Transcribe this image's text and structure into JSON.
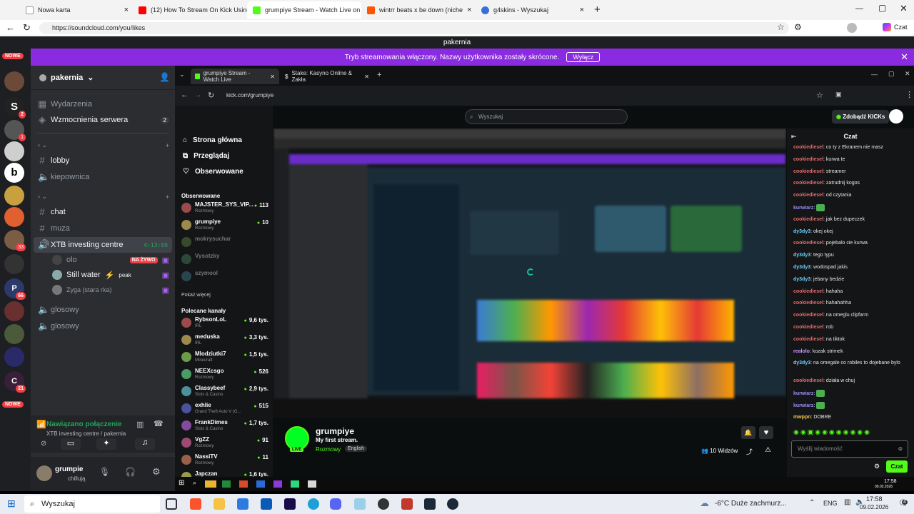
{
  "browser": {
    "tabs": [
      {
        "title": "Nowa karta"
      },
      {
        "title": "(12) How To Stream On Kick Using"
      },
      {
        "title": "grumpiye Stream - Watch Live on"
      },
      {
        "title": "wintrr beats x be down (niche"
      },
      {
        "title": "g4skins - Wyszukaj"
      }
    ],
    "url": "https://soundcloud.com/you/likes",
    "profile_label": "Czat"
  },
  "discord": {
    "window_title": "pakernia",
    "banner_text": "Tryb streamowania włączony. Nazwy użytkownika zostały skrócone.",
    "banner_button": "Wyłącz",
    "new_badge": "NOWE",
    "guild_badges": [
      "2",
      "1",
      "33",
      "66",
      "21"
    ],
    "server_name": "pakernia",
    "items": [
      {
        "label": "Wydarzenia"
      },
      {
        "label": "Wzmocnienia serwera",
        "badge": "2"
      }
    ],
    "channels": [
      {
        "label": "lobby"
      },
      {
        "label": "kiepownica"
      },
      {
        "label": "chat"
      },
      {
        "label": "muza"
      },
      {
        "label": "XTB investing centre",
        "time": "4:13:09"
      }
    ],
    "voice_users": [
      {
        "name": "olo",
        "badge": "NA ŻYWO"
      },
      {
        "name": "Still water",
        "extra": "peak"
      },
      {
        "name": "Zyga (stara rka)"
      }
    ],
    "more_channels": [
      "glosowy",
      "glosowy"
    ],
    "voice_status": "Nawiązano połączenie",
    "voice_sub": "XTB investing centre / pakernia",
    "user_name": "grumpie",
    "user_status": "chillują"
  },
  "kick": {
    "tabs": [
      "grumpiye Stream - Watch Live",
      "Stake: Kasyno Online & Zakła"
    ],
    "url": "kick.com/grumpiye",
    "search_placeholder": "Wyszukaj",
    "get_kicks": "Zdobądź KICKs",
    "nav": [
      "Strona główna",
      "Przeglądaj",
      "Obserwowane"
    ],
    "followed_header": "Obserwowane",
    "followed": [
      {
        "name": "MAJSTER_SYS_VIP...",
        "cat": "Rozmowy",
        "viewers": "113"
      },
      {
        "name": "grumpiye",
        "cat": "Rozmowy",
        "viewers": "10"
      },
      {
        "name": "mokrysuchar",
        "cat": "",
        "viewers": ""
      },
      {
        "name": "Vysotzky",
        "cat": "",
        "viewers": ""
      },
      {
        "name": "szymool",
        "cat": "",
        "viewers": ""
      }
    ],
    "show_more": "Pokaż więcej",
    "recommended_header": "Polecane kanały",
    "recommended": [
      {
        "name": "RybsonLoL",
        "cat": "IRL",
        "viewers": "9,6 tys."
      },
      {
        "name": "meduska",
        "cat": "IRL",
        "viewers": "3,3 tys."
      },
      {
        "name": "Mlodziutki7",
        "cat": "Minecraft",
        "viewers": "1,5 tys."
      },
      {
        "name": "NEEXcsgo",
        "cat": "Rozmowy",
        "viewers": "526"
      },
      {
        "name": "Classybeef",
        "cat": "Slots & Casino",
        "viewers": "2,9 tys."
      },
      {
        "name": "exhlie",
        "cat": "Grand Theft Auto V (G...",
        "viewers": "515"
      },
      {
        "name": "FrankDimes",
        "cat": "Slots & Casino",
        "viewers": "1,7 tys."
      },
      {
        "name": "VgZZ",
        "cat": "Rozmowy",
        "viewers": "91"
      },
      {
        "name": "NassiTV",
        "cat": "Rozmowy",
        "viewers": "11"
      },
      {
        "name": "Japczan",
        "cat": "",
        "viewers": "1,6 tys."
      }
    ],
    "streamer": "grumpiye",
    "stream_title": "My first stream.",
    "stream_cat": "Rozmowy",
    "stream_lang": "English",
    "viewers_label": "10 Widzów",
    "live_badge": "LIVE",
    "chat_title": "Czat",
    "chat_placeholder": "Wyślij wiadomość",
    "chat_send": "Czat",
    "chat": [
      {
        "user": "cookiediesel",
        "msg": "co ty z Ekranem nie masz",
        "color": "#e66b6b"
      },
      {
        "user": "cookiediesel",
        "msg": "kurwa te",
        "color": "#e66b6b"
      },
      {
        "user": "cookiediesel",
        "msg": "streamer",
        "color": "#e66b6b"
      },
      {
        "user": "cookiediesel",
        "msg": "zatrudnij kogos",
        "color": "#e66b6b"
      },
      {
        "user": "cookiediesel",
        "msg": "od czytania",
        "color": "#e66b6b"
      },
      {
        "user": "kurwiarz",
        "msg": "",
        "color": "#9b8cff"
      },
      {
        "user": "cookiediesel",
        "msg": "jak bez dupeczek",
        "color": "#e66b6b"
      },
      {
        "user": "dy3dy3",
        "msg": "okej okej",
        "color": "#6fd0ff"
      },
      {
        "user": "cookiediesel",
        "msg": "pojebalo cie kurwa",
        "color": "#e66b6b"
      },
      {
        "user": "dy3dy3",
        "msg": "tego typu",
        "color": "#6fd0ff"
      },
      {
        "user": "dy3dy3",
        "msg": "wodospad jakis",
        "color": "#6fd0ff"
      },
      {
        "user": "dy3dy3",
        "msg": "jebany bedzie",
        "color": "#6fd0ff"
      },
      {
        "user": "cookiediesel",
        "msg": "hahaha",
        "color": "#e66b6b"
      },
      {
        "user": "cookiediesel",
        "msg": "hahahahha",
        "color": "#e66b6b"
      },
      {
        "user": "cookiediesel",
        "msg": "na omeglu clipfarm",
        "color": "#e66b6b"
      },
      {
        "user": "cookiediesel",
        "msg": "rob",
        "color": "#e66b6b"
      },
      {
        "user": "cookiediesel",
        "msg": "na tiktok",
        "color": "#e66b6b"
      },
      {
        "user": "realolo",
        "msg": "kozak strimek",
        "color": "#c39bff"
      },
      {
        "user": "dy3dy3",
        "msg": "na omegale co robiles to dojebane bylo",
        "color": "#6fd0ff"
      },
      {
        "user": "cookiediesel",
        "msg": "działa w chuj",
        "color": "#e66b6b"
      },
      {
        "user": "kurwiarz",
        "msg": "",
        "color": "#9b8cff"
      },
      {
        "user": "kurwiarz",
        "msg": "",
        "color": "#9b8cff"
      },
      {
        "user": "mwppn",
        "msg": "DOBRE",
        "color": "#f2c94c"
      }
    ]
  },
  "taskbar": {
    "search": "Wyszukaj",
    "weather": "-6°C  Duże zachmurz...",
    "lang": "ENG",
    "time": "17:58",
    "date": "09.02.2026",
    "inner_time": "17:58",
    "inner_date": "09.02.2026",
    "notif": "4"
  }
}
